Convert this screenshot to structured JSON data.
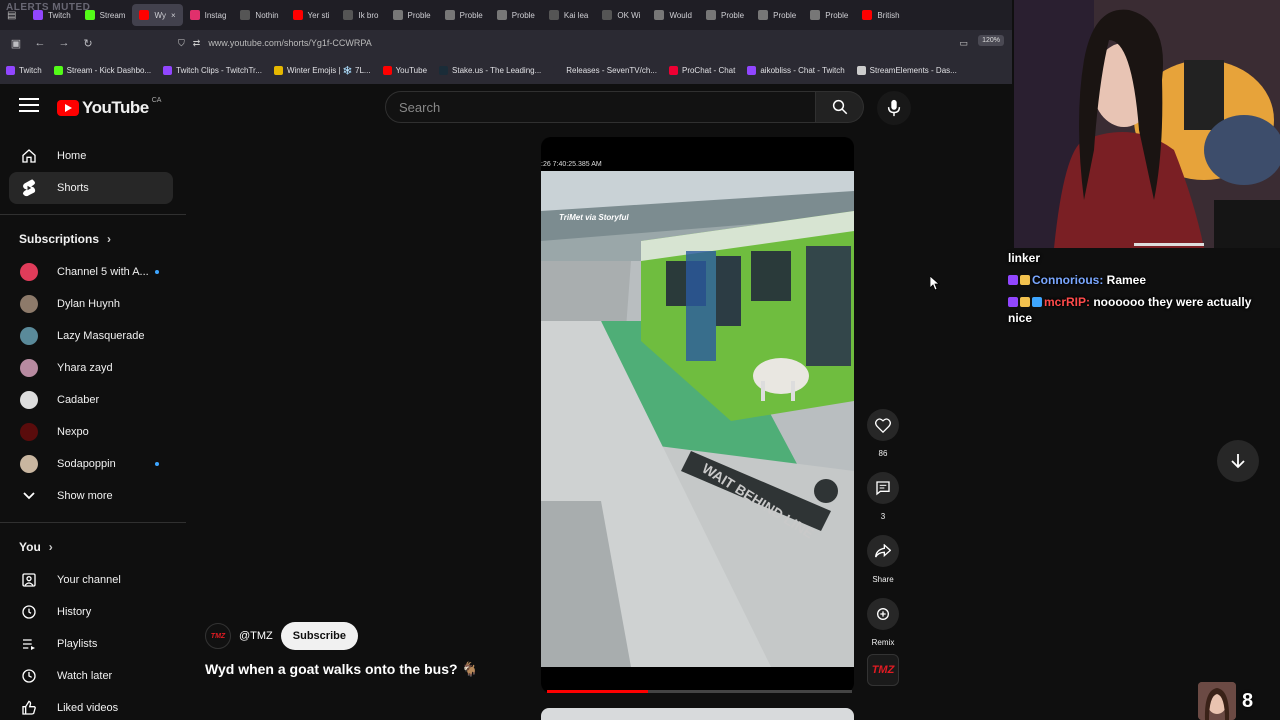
{
  "overlay": {
    "alerts_muted": "ALERTS MUTED",
    "chat": [
      {
        "user": "linker",
        "message": "",
        "user_color": "#ffffff"
      },
      {
        "user": "Connorious:",
        "message": " Ramee",
        "user_color": "#7aa7ff"
      },
      {
        "user": "mcrRIP:",
        "message": " noooooo they were actually nice",
        "user_color": "#ff4b4b"
      }
    ],
    "sub_count": "8"
  },
  "browser": {
    "tabs": [
      {
        "label": "Twitch",
        "color": "#9146ff"
      },
      {
        "label": "Stream",
        "color": "#53fc18"
      },
      {
        "label": "Wy",
        "color": "#ff0000",
        "active": true
      },
      {
        "label": "Instag",
        "color": "#e1306c"
      },
      {
        "label": "Nothin",
        "color": "#555"
      },
      {
        "label": "Yer sti",
        "color": "#ff0000"
      },
      {
        "label": "Ik bro",
        "color": "#555"
      },
      {
        "label": "Proble",
        "color": "#777"
      },
      {
        "label": "Proble",
        "color": "#777"
      },
      {
        "label": "Proble",
        "color": "#777"
      },
      {
        "label": "Kai lea",
        "color": "#555"
      },
      {
        "label": "OK Wi",
        "color": "#555"
      },
      {
        "label": "Would",
        "color": "#777"
      },
      {
        "label": "Proble",
        "color": "#777"
      },
      {
        "label": "Proble",
        "color": "#777"
      },
      {
        "label": "Proble",
        "color": "#777"
      },
      {
        "label": "British",
        "color": "#ff0000"
      }
    ],
    "url": "www.youtube.com/shorts/Yg1f-CCWRPA",
    "zoom": "120%",
    "bookmarks": [
      {
        "label": "Twitch",
        "color": "#9146ff"
      },
      {
        "label": "Stream - Kick Dashbo...",
        "color": "#53fc18"
      },
      {
        "label": "Twitch Clips - TwitchTr...",
        "color": "#9146ff"
      },
      {
        "label": "Winter Emojis | ❄️ 7L...",
        "color": "#e6b800"
      },
      {
        "label": "YouTube",
        "color": "#ff0000"
      },
      {
        "label": "Stake.us - The Leading...",
        "color": "#1a2c38"
      },
      {
        "label": "Releases - SevenTV/ch...",
        "color": "#2b2a33"
      },
      {
        "label": "ProChat - Chat",
        "color": "#e03"
      },
      {
        "label": "aikobliss - Chat - Twitch",
        "color": "#9146ff"
      },
      {
        "label": "StreamElements - Das...",
        "color": "#ccc"
      }
    ]
  },
  "youtube": {
    "logo_text": "YouTube",
    "country": "CA",
    "search_placeholder": "Search",
    "sidebar": {
      "home": "Home",
      "shorts": "Shorts",
      "subscriptions_header": "Subscriptions",
      "subscriptions": [
        {
          "name": "Channel 5 with A...",
          "dot": true,
          "color": "#e03c5a"
        },
        {
          "name": "Dylan Huynh",
          "dot": false,
          "color": "#8d7a6a"
        },
        {
          "name": "Lazy Masquerade",
          "dot": false,
          "color": "#5a8a9a"
        },
        {
          "name": "Yhara zayd",
          "dot": false,
          "color": "#b78aa0"
        },
        {
          "name": "Cadaber",
          "dot": false,
          "color": "#ddd"
        },
        {
          "name": "Nexpo",
          "dot": false,
          "color": "#5a0c0c"
        },
        {
          "name": "Sodapoppin",
          "dot": true,
          "color": "#c9b6a0"
        }
      ],
      "show_more": "Show more",
      "you_header": "You",
      "you_items": [
        {
          "label": "Your channel",
          "icon": "person-icon"
        },
        {
          "label": "History",
          "icon": "history-icon"
        },
        {
          "label": "Playlists",
          "icon": "playlist-icon"
        },
        {
          "label": "Watch later",
          "icon": "clock-icon"
        },
        {
          "label": "Liked videos",
          "icon": "thumbs-up-icon"
        }
      ]
    },
    "short": {
      "timestamp": ":26 7:40:25.385 AM",
      "credit": "TriMet via Storyful",
      "progress": 0.33,
      "channel_handle": "@TMZ",
      "channel_avatar": "TMZ",
      "subscribe": "Subscribe",
      "title": "Wyd when a goat walks onto the bus? 🐐",
      "likes": "86",
      "comments": "3",
      "share": "Share",
      "remix": "Remix",
      "sound_thumb": "TMZ"
    }
  }
}
